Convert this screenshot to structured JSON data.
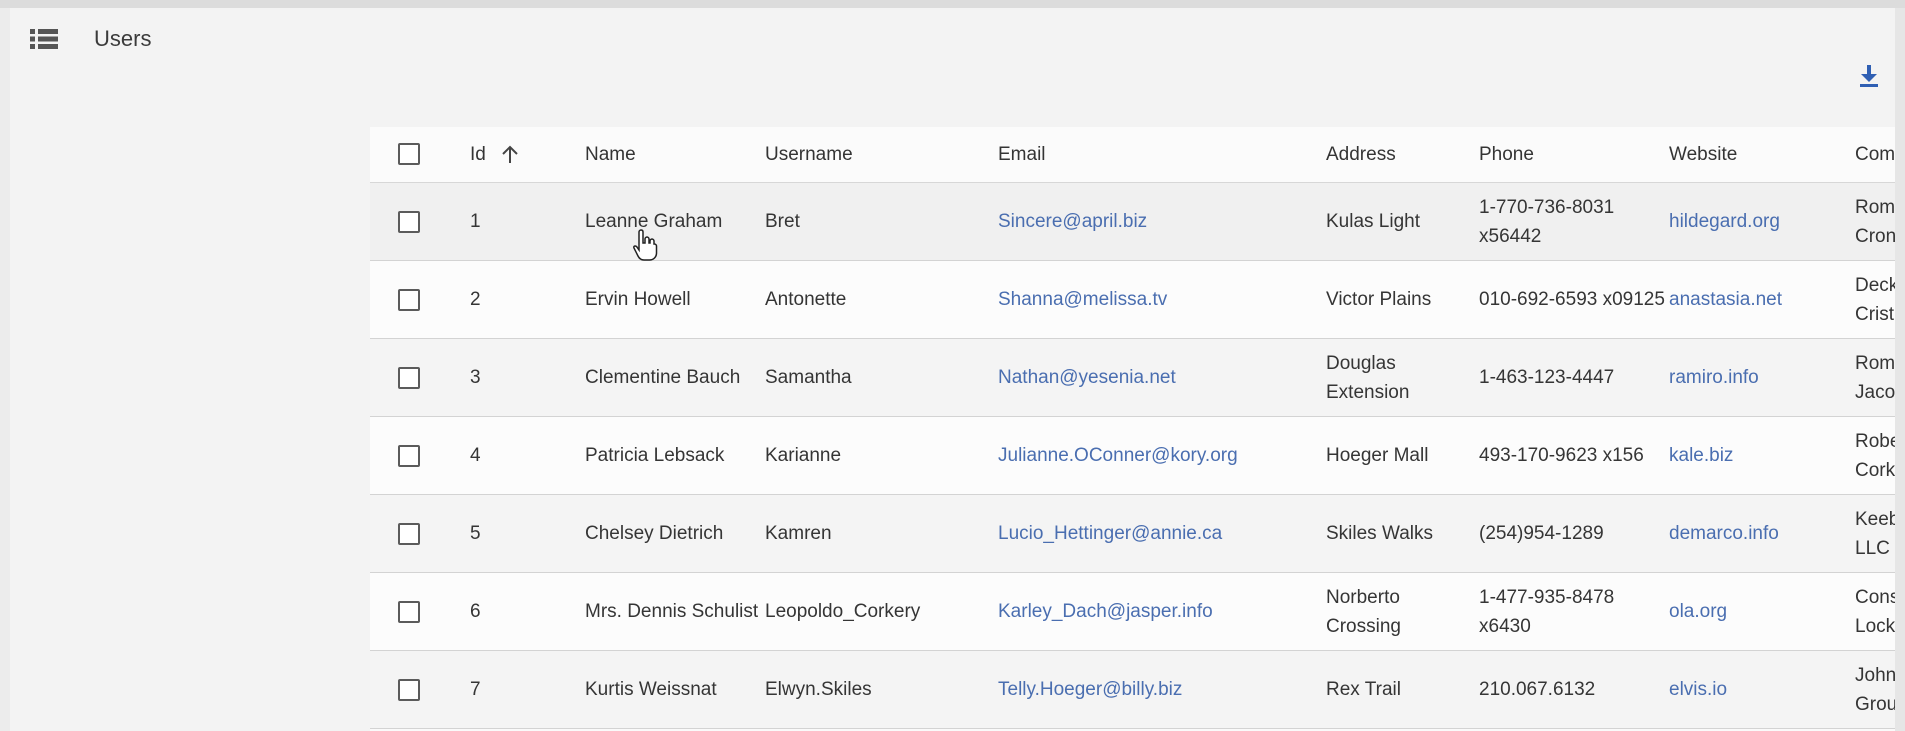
{
  "header": {
    "title": "Users",
    "list_icon": "list-icon",
    "download_icon": "download-icon"
  },
  "table": {
    "columns": {
      "select": "",
      "id": "Id",
      "name": "Name",
      "username": "Username",
      "email": "Email",
      "address": "Address",
      "phone": "Phone",
      "website": "Website",
      "company": "Com"
    },
    "sort": {
      "column": "Id",
      "direction": "ascending",
      "icon": "arrow-up-icon"
    },
    "rows": [
      {
        "id": "1",
        "name": "Leanne Graham",
        "username": "Bret",
        "email": "Sincere@april.biz",
        "address": "Kulas Light",
        "phone": "1-770-736-8031 x56442",
        "website": "hildegard.org",
        "company": "Romaguera-Crona"
      },
      {
        "id": "2",
        "name": "Ervin Howell",
        "username": "Antonette",
        "email": "Shanna@melissa.tv",
        "address": "Victor Plains",
        "phone": "010-692-6593 x09125",
        "website": "anastasia.net",
        "company": "Deckow-Crist"
      },
      {
        "id": "3",
        "name": "Clementine Bauch",
        "username": "Samantha",
        "email": "Nathan@yesenia.net",
        "address": "Douglas Extension",
        "phone": "1-463-123-4447",
        "website": "ramiro.info",
        "company": "Romaguera-Jacobson"
      },
      {
        "id": "4",
        "name": "Patricia Lebsack",
        "username": "Karianne",
        "email": "Julianne.OConner@kory.org",
        "address": "Hoeger Mall",
        "phone": "493-170-9623 x156",
        "website": "kale.biz",
        "company": "Robel-Corkery"
      },
      {
        "id": "5",
        "name": "Chelsey Dietrich",
        "username": "Kamren",
        "email": "Lucio_Hettinger@annie.ca",
        "address": "Skiles Walks",
        "phone": "(254)954-1289",
        "website": "demarco.info",
        "company": "Keebler LLC"
      },
      {
        "id": "6",
        "name": "Mrs. Dennis Schulist",
        "username": "Leopoldo_Corkery",
        "email": "Karley_Dach@jasper.info",
        "address": "Norberto Crossing",
        "phone": "1-477-935-8478 x6430",
        "website": "ola.org",
        "company": "Considine-Lockman"
      },
      {
        "id": "7",
        "name": "Kurtis Weissnat",
        "username": "Elwyn.Skiles",
        "email": "Telly.Hoeger@billy.biz",
        "address": "Rex Trail",
        "phone": "210.067.6132",
        "website": "elvis.io",
        "company": "Johns Group"
      }
    ]
  },
  "colors": {
    "link": "#4a6eb0",
    "text": "#353535",
    "border": "#d3d3d3"
  },
  "cursor": "hand-pointer-icon"
}
